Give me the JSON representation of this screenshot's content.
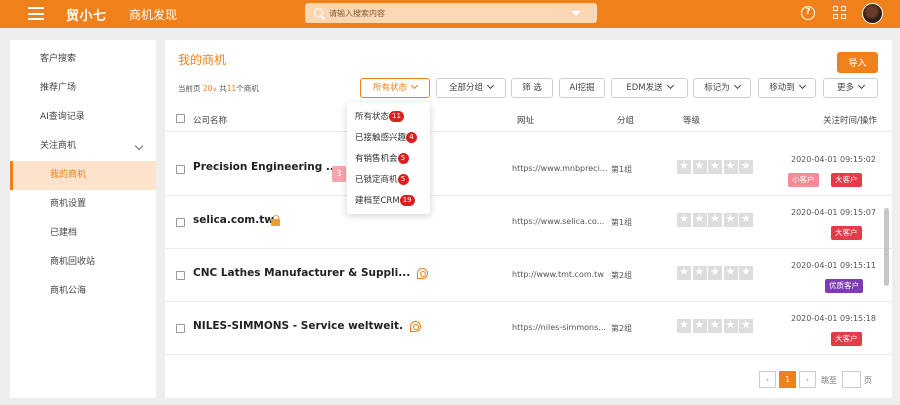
{
  "topbar": {
    "logo": "贸小七",
    "title": "商机发现",
    "search_placeholder": "请输入搜索内容"
  },
  "icons": [
    "menu-icon",
    "search-icon",
    "caret-down-icon",
    "help-icon",
    "apps-icon",
    "lock-icon",
    "chat-icon",
    "chevron-down-icon"
  ],
  "colors": {
    "brand": "#f08019",
    "tag_red": "#e33b48",
    "tag_pink": "#f28b95",
    "tag_purple": "#7f3bb6",
    "badge": "#d9201f"
  },
  "sidebar": {
    "items": [
      {
        "label": "客户搜索"
      },
      {
        "label": "推荐广场"
      },
      {
        "label": "AI查询记录"
      },
      {
        "label": "关注商机"
      },
      {
        "label": "我的商机"
      },
      {
        "label": "商机设置"
      },
      {
        "label": "已建档"
      },
      {
        "label": "商机回收站"
      },
      {
        "label": "商机公海"
      }
    ]
  },
  "main": {
    "title": "我的商机",
    "import_label": "导入",
    "summary": {
      "prefix": "当前页",
      "page_size": "20",
      "mid": "共",
      "total": "11",
      "suffix": "个商机"
    },
    "toolbar": {
      "status": "所有状态",
      "group": "全部分组",
      "filter": "筛 选",
      "ai": "AI挖掘",
      "edm": "EDM发送",
      "mark": "标记为",
      "move": "移动到",
      "more": "更多"
    },
    "columns": {
      "company": "公司名称",
      "url": "网址",
      "group": "分组",
      "level": "等级",
      "time": "关注时间/操作"
    }
  },
  "rows": [
    {
      "name": "Precision Engineering ...",
      "count": "3",
      "url": "https://www.mnbpreci...",
      "group": "第1组",
      "time": "2020-04-01 09:15:02",
      "tags": [
        "小客户",
        "大客户"
      ]
    },
    {
      "name": "selica.com.tw",
      "url": "https://www.selica.co...",
      "group": "第1组",
      "time": "2020-04-01 09:15:07",
      "tags": [
        "大客户"
      ]
    },
    {
      "name": "CNC Lathes Manufacturer & Suppli...",
      "url": "http://www.tmt.com.tw",
      "group": "第2组",
      "time": "2020-04-01 09:15:11",
      "tags": [
        "优质客户"
      ]
    },
    {
      "name": "NILES-SIMMONS - Service weltweit.",
      "url": "https://niles-simmons...",
      "group": "第2组",
      "time": "2020-04-01 09:15:18",
      "tags": [
        "大客户"
      ]
    }
  ],
  "pagination": {
    "current": "1",
    "prev": "‹",
    "next": "›",
    "goto": "跳至",
    "page_unit": "页"
  },
  "status_dropdown": {
    "items": [
      {
        "label": "所有状态",
        "count": "11"
      },
      {
        "label": "已接触感兴趣",
        "count": "4"
      },
      {
        "label": "有销售机会",
        "count": "5"
      },
      {
        "label": "已锁定商机",
        "count": "5"
      },
      {
        "label": "建档至CRM",
        "count": "19"
      }
    ]
  }
}
